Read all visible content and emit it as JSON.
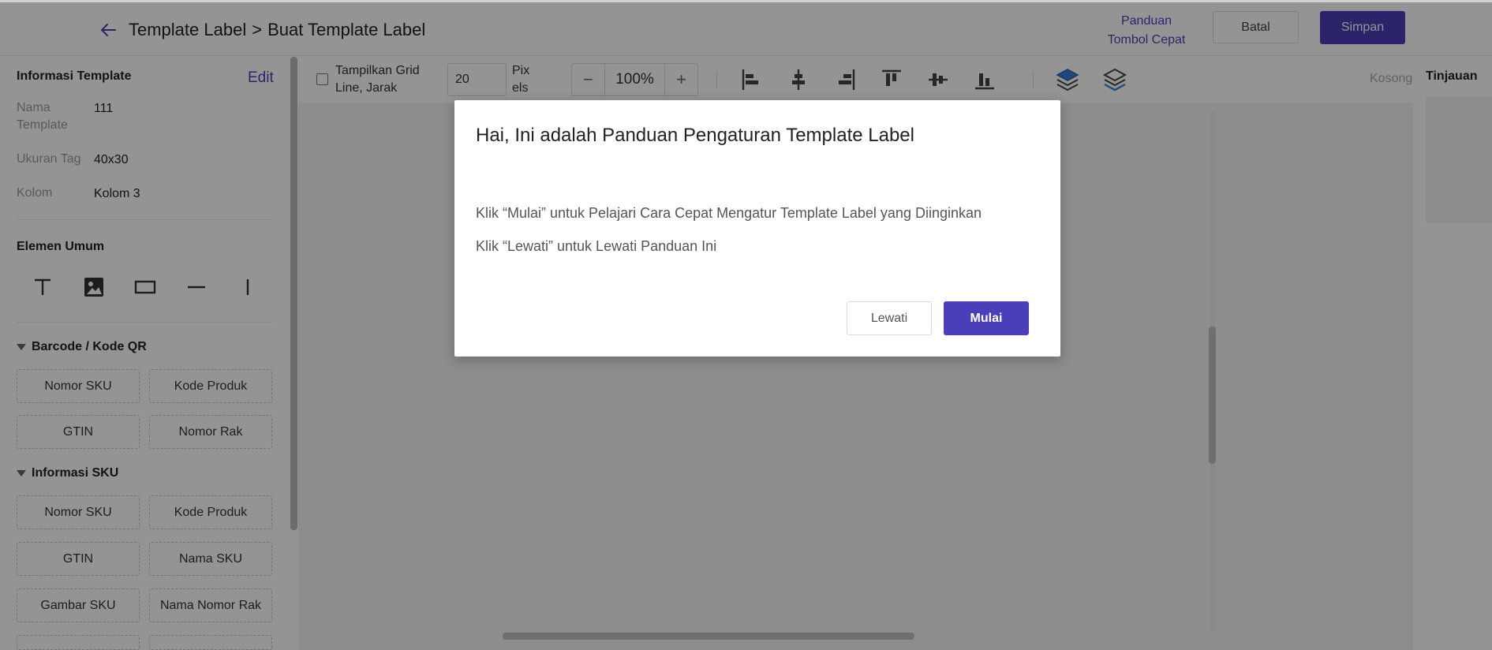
{
  "header": {
    "title_parent": "Template Label",
    "title_separator": ">",
    "title_current": "Buat Template Label",
    "guide_line1": "Panduan",
    "guide_line2": "Tombol Cepat",
    "cancel_label": "Batal",
    "save_label": "Simpan"
  },
  "sidebar": {
    "info_title": "Informasi Template",
    "edit_label": "Edit",
    "fields": [
      {
        "label": "Nama Template",
        "value": "111"
      },
      {
        "label": "Ukuran Tag",
        "value": "40x30"
      },
      {
        "label": "Kolom",
        "value": "Kolom 3"
      }
    ],
    "general_title": "Elemen Umum",
    "general_tools": [
      "text-icon",
      "image-icon",
      "rectangle-icon",
      "horizontal-line-icon",
      "vertical-line-icon"
    ],
    "barcode_title": "Barcode / Kode QR",
    "barcode_items": [
      "Nomor SKU",
      "Kode Produk",
      "GTIN",
      "Nomor Rak"
    ],
    "sku_title": "Informasi SKU",
    "sku_items": [
      "Nomor SKU",
      "Kode Produk",
      "GTIN",
      "Nama SKU",
      "Gambar SKU",
      "Nama Nomor Rak"
    ]
  },
  "toolbar": {
    "grid_label": "Tampilkan Grid Line, Jarak",
    "grid_checked": false,
    "spacing_value": "20",
    "spacing_unit": "Pix els",
    "zoom_minus": "−",
    "zoom_value": "100%",
    "zoom_plus": "+",
    "empty_text": "Kosong"
  },
  "preview": {
    "title": "Tinjauan"
  },
  "modal": {
    "title": "Hai, Ini adalah Panduan Pengaturan Template Label",
    "line1": "Klik “Mulai” untuk Pelajari Cara Cepat Mengatur Template Label yang Diinginkan",
    "line2": "Klik “Lewati” untuk Lewati Panduan Ini",
    "skip_label": "Lewati",
    "start_label": "Mulai"
  },
  "colors": {
    "accent": "#4b3fb9",
    "layer_icon": "#3a7bd5"
  }
}
